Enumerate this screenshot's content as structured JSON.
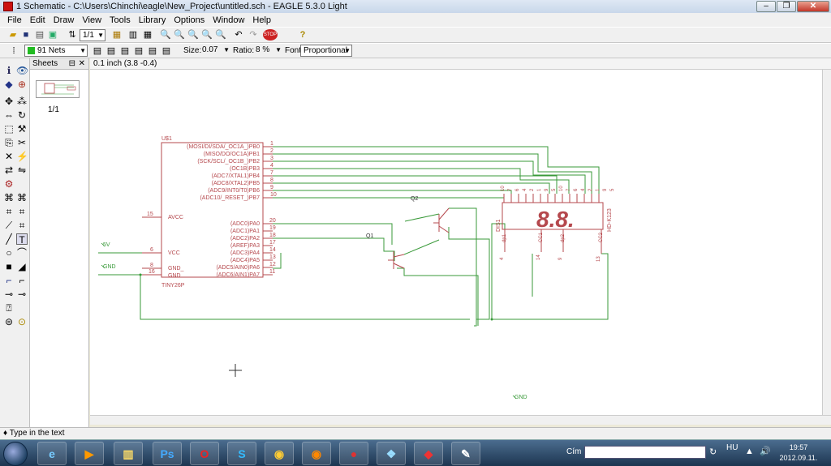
{
  "window": {
    "title": "1 Schematic - C:\\Users\\Chinchi\\eagle\\New_Project\\untitled.sch - EAGLE 5.3.0 Light"
  },
  "menu": [
    "File",
    "Edit",
    "Draw",
    "View",
    "Tools",
    "Library",
    "Options",
    "Window",
    "Help"
  ],
  "toolbar1": {
    "sheet_select": "1/1"
  },
  "toolbar2": {
    "layer": "91 Nets",
    "size_label": "Size:",
    "size_value": "0.07",
    "ratio_label": "Ratio:",
    "ratio_value": "8 %",
    "font_label": "Font:",
    "font_value": "Proportional"
  },
  "sheets_panel": {
    "title": "Sheets",
    "page": "1/1"
  },
  "coord_readout": "0.1 inch (3.8 -0.4)",
  "status": "Type in the text",
  "schematic": {
    "ic_name": "U$1",
    "ic_value": "TINY26P",
    "left_pins": [
      {
        "num": "15",
        "name": "AVCC"
      },
      {
        "num": "6",
        "name": "VCC"
      },
      {
        "num": "8",
        "name": "GND_"
      },
      {
        "num": "16",
        "name": "GND"
      }
    ],
    "right_pins": [
      {
        "num": "1",
        "name": "(MOSI/DI/SDA/_OC1A_)PB0"
      },
      {
        "num": "2",
        "name": "(MISO/DO/OC1A)PB1"
      },
      {
        "num": "3",
        "name": "(SCK/SCL/_OC1B_)PB2"
      },
      {
        "num": "4",
        "name": "(OC1B)PB3"
      },
      {
        "num": "7",
        "name": "(ADC7/XTAL1)PB4"
      },
      {
        "num": "8",
        "name": "(ADC8/XTAL2)PB5"
      },
      {
        "num": "9",
        "name": "(ADC9/INT0/T0)PB6"
      },
      {
        "num": "10",
        "name": "(ADC10/_RESET_)PB7"
      },
      {
        "num": "20",
        "name": "(ADC0)PA0"
      },
      {
        "num": "19",
        "name": "(ADC1)PA1"
      },
      {
        "num": "18",
        "name": "(ADC2)PA2"
      },
      {
        "num": "17",
        "name": "(AREF)PA3"
      },
      {
        "num": "14",
        "name": "(ADC3)PA4"
      },
      {
        "num": "13",
        "name": "(ADC4)PA5"
      },
      {
        "num": "12",
        "name": "(ADC5/AIN0)PA6"
      },
      {
        "num": "11",
        "name": "(ADC6/AIN1)PA7"
      }
    ],
    "net_5v": "5V",
    "net_gnd": "GND",
    "net_gnd2": "GND",
    "q1": "Q1",
    "q2": "Q2",
    "display_name": "DIS1",
    "display_value": "HD-K123",
    "display_digits": "8.8.",
    "display_top_pins": [
      "10",
      "7",
      "6",
      "4",
      "2",
      "1",
      "9",
      "5",
      "10",
      "7",
      "6",
      "4",
      "2",
      "1",
      "9",
      "5"
    ],
    "display_bottom": [
      {
        "num": "4",
        "name": "dp1"
      },
      {
        "num": "14",
        "name": "CC1"
      },
      {
        "num": "9",
        "name": "dp2"
      },
      {
        "num": "13",
        "name": "CC2"
      }
    ]
  },
  "taskbar": {
    "search_label": "Cím",
    "lang": "HU",
    "time": "19:57",
    "date": "2012.09.11."
  },
  "colors": {
    "part": "#b5484d",
    "net": "#3a9a3a",
    "digits": "#b5484d"
  }
}
